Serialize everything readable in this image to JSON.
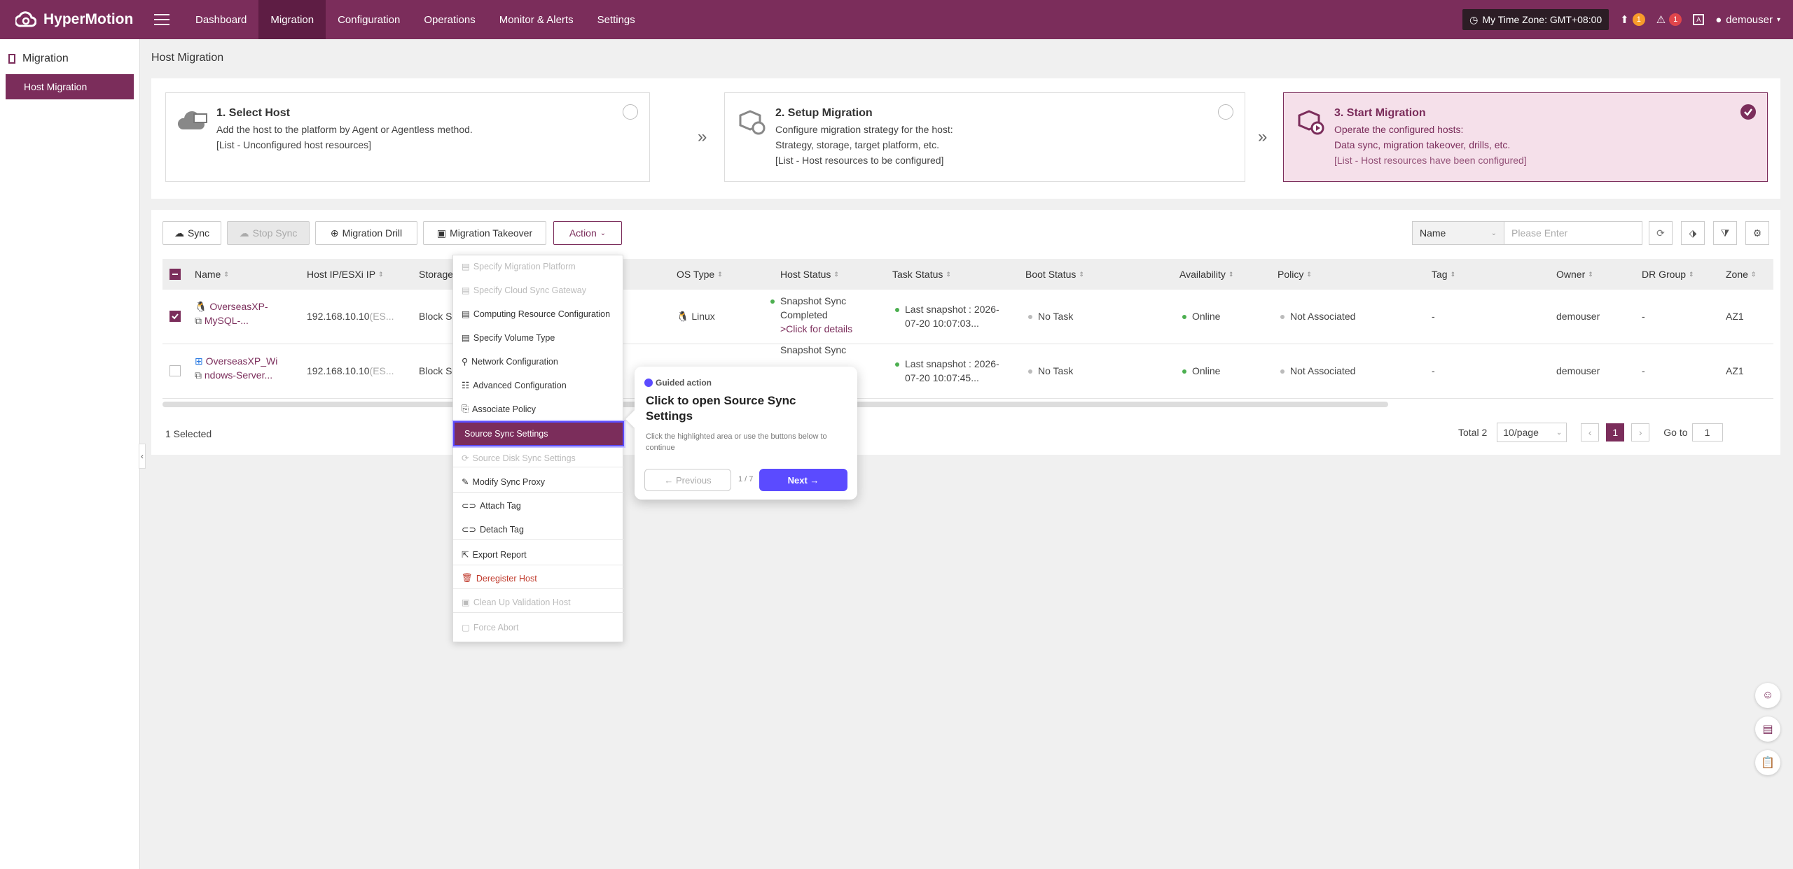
{
  "app": {
    "name": "HyperMotion"
  },
  "nav": [
    "Dashboard",
    "Migration",
    "Configuration",
    "Operations",
    "Monitor & Alerts",
    "Settings"
  ],
  "topbar": {
    "timezone": "My Time Zone: GMT+08:00",
    "upload_count": "1",
    "alert_count": "1",
    "user": "demouser"
  },
  "sidebar": {
    "section": "Migration",
    "item": "Host Migration"
  },
  "page_title": "Host Migration",
  "steps": [
    {
      "title": "1. Select Host",
      "line1": "Add the host to the platform by Agent or Agentless method.",
      "line2": "[List - Unconfigured host resources]",
      "line3": ""
    },
    {
      "title": "2. Setup Migration",
      "line1": "Configure migration strategy for the host:",
      "line2": "Strategy, storage, target platform, etc.",
      "line3": "[List - Host resources to be configured]"
    },
    {
      "title": "3. Start Migration",
      "line1": "Operate the configured hosts:",
      "line2": "Data sync, migration takeover, drills, etc.",
      "line3": "[List - Host resources have been configured]"
    }
  ],
  "toolbar": {
    "sync": "Sync",
    "stop_sync": "Stop Sync",
    "drill": "Migration Drill",
    "takeover": "Migration Takeover",
    "action": "Action"
  },
  "filter": {
    "field": "Name",
    "placeholder": "Please Enter"
  },
  "columns": [
    "Name",
    "Host IP/ESXi IP",
    "Storage",
    "OS Type",
    "Host Status",
    "Task Status",
    "Boot Status",
    "Availability",
    "Policy",
    "Tag",
    "Owner",
    "DR Group",
    "Zone"
  ],
  "rows": [
    {
      "name1": "OverseasXP-",
      "name2": "MySQL-...",
      "ip": "192.168.10.10",
      "ip_suffix": "(ES...",
      "storage": "Block S",
      "os": "Linux",
      "host_status1": "Snapshot Sync",
      "host_status2": "Completed",
      "host_status3": ">Click for details",
      "task1": "Last snapshot : 2026-",
      "task2": "07-20 10:07:03...",
      "boot": "No Task",
      "availability": "Online",
      "policy": "Not Associated",
      "tag": "-",
      "owner": "demouser",
      "dr": "-",
      "zone": "AZ1"
    },
    {
      "name1": "OverseasXP_Wi",
      "name2": "ndows-Server...",
      "ip": "192.168.10.10",
      "ip_suffix": "(ES...",
      "storage": "Block S",
      "os": "",
      "host_status1": "Snapshot Sync",
      "host_status2": "",
      "host_status3": "",
      "task1": "Last snapshot : 2026-",
      "task2": "07-20 10:07:45...",
      "boot": "No Task",
      "availability": "Online",
      "policy": "Not Associated",
      "tag": "-",
      "owner": "demouser",
      "dr": "-",
      "zone": "AZ1"
    }
  ],
  "footer": {
    "selected": "1 Selected",
    "total": "Total 2",
    "page_size": "10/page",
    "page": "1",
    "goto_label": "Go to",
    "goto_value": "1"
  },
  "action_menu": [
    {
      "label": "Specify Migration Platform",
      "disabled": true
    },
    {
      "label": "Specify Cloud Sync Gateway",
      "disabled": true
    },
    {
      "label": "Computing Resource Configuration",
      "disabled": false
    },
    {
      "label": "Specify Volume Type",
      "disabled": false
    },
    {
      "label": "Network Configuration",
      "disabled": false
    },
    {
      "label": "Advanced Configuration",
      "disabled": false
    },
    {
      "label": "Associate Policy",
      "disabled": false
    },
    {
      "label": "Source Sync Settings",
      "disabled": false
    },
    {
      "label": "Source Disk Sync Settings",
      "disabled": true
    },
    {
      "label": "Modify Sync Proxy",
      "disabled": false
    },
    {
      "label": "Attach Tag",
      "disabled": false
    },
    {
      "label": "Detach Tag",
      "disabled": false
    },
    {
      "label": "Export Report",
      "disabled": false
    },
    {
      "label": "Deregister Host",
      "disabled": false
    },
    {
      "label": "Clean Up Validation Host",
      "disabled": true
    },
    {
      "label": "Force Abort",
      "disabled": true
    }
  ],
  "guide": {
    "label": "Guided action",
    "title": "Click to open Source Sync Settings",
    "subtitle": "Click the highlighted area or use the buttons below to continue",
    "prev": "← Previous",
    "counter": "1 / 7",
    "next": "Next →"
  },
  "colors": {
    "brand": "#7b2d5b",
    "accent": "#5b4bff",
    "online": "#4caf50"
  }
}
